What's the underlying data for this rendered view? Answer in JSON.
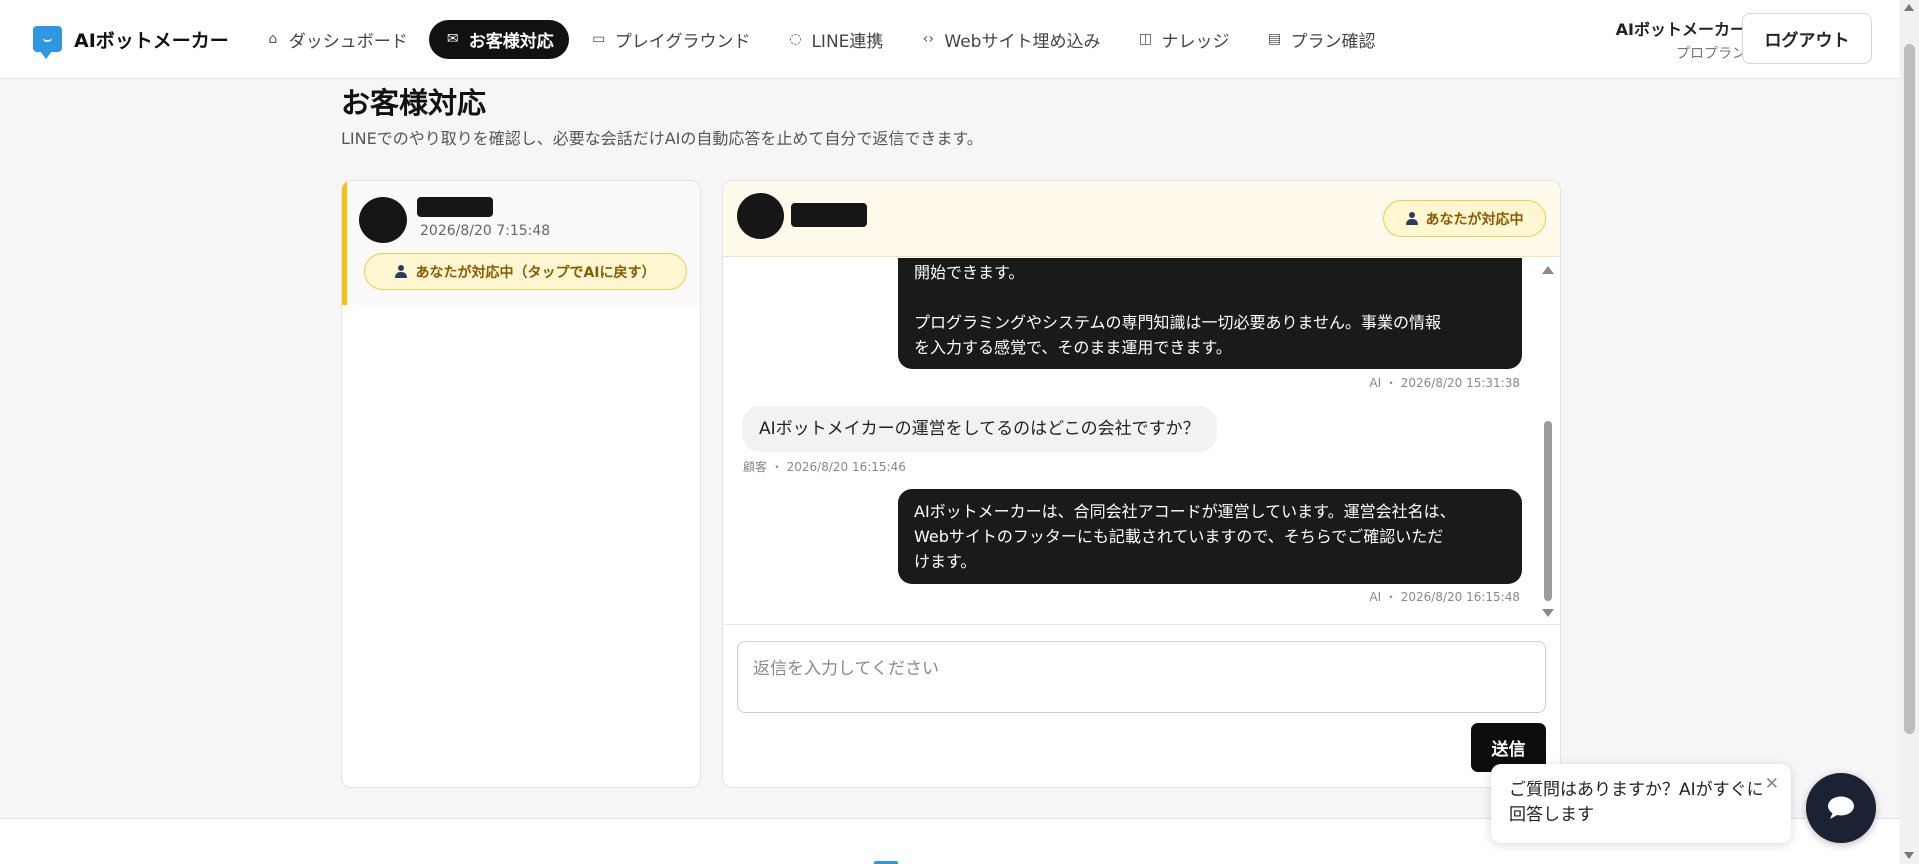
{
  "header": {
    "brand_name": "AIボットメーカー",
    "nav": [
      {
        "label": "ダッシュボード",
        "icon": "home-icon",
        "active": false
      },
      {
        "label": "お客様対応",
        "icon": "inbox-icon",
        "active": true
      },
      {
        "label": "プレイグラウンド",
        "icon": "chat-icon",
        "active": false
      },
      {
        "label": "LINE連携",
        "icon": "line-icon",
        "active": false
      },
      {
        "label": "Webサイト埋め込み",
        "icon": "code-icon",
        "active": false
      },
      {
        "label": "ナレッジ",
        "icon": "book-icon",
        "active": false
      },
      {
        "label": "プラン確認",
        "icon": "card-icon",
        "active": false
      }
    ],
    "account_name": "AIボットメーカー",
    "account_plan": "プロプラン",
    "logout_label": "ログアウト"
  },
  "page": {
    "title": "お客様対応",
    "subtitle": "LINEでのやり取りを確認し、必要な会話だけAIの自動応答を止めて自分で返信できます。"
  },
  "conversations": [
    {
      "time": "2026/8/20 7:15:48",
      "badge": "あなたが対応中（タップでAIに戻す）"
    }
  ],
  "chat": {
    "status_badge": "あなたが対応中",
    "messages": [
      {
        "sender": "ai",
        "lines": [
          "開始できます。",
          "",
          "プログラミングやシステムの専門知識は一切必要ありません。事業の情報",
          "を入力する感覚で、そのまま運用できます。"
        ],
        "meta": "AI ・ 2026/8/20 15:31:38"
      },
      {
        "sender": "customer",
        "text": "AIボットメイカーの運営をしてるのはどこの会社ですか？",
        "meta": "顧客 ・ 2026/8/20 16:15:46"
      },
      {
        "sender": "ai",
        "lines": [
          "AIボットメーカーは、合同会社アコードが運営しています。運営会社名は、",
          "Webサイトのフッターにも記載されていますので、そちらでご確認いただ",
          "けます。"
        ],
        "meta": "AI ・ 2026/8/20 16:15:48"
      }
    ],
    "reply_placeholder": "返信を入力してください",
    "send_label": "送信"
  },
  "widget": {
    "tip_text": "ご質問はありますか？AIがすぐに回答します",
    "close_glyph": "✕"
  },
  "colors": {
    "brand": "#2f97e2",
    "accent_dark": "#111111",
    "badge_bg": "#fff6d2",
    "badge_border": "#f0cd52",
    "badge_text": "#8a5a00"
  }
}
